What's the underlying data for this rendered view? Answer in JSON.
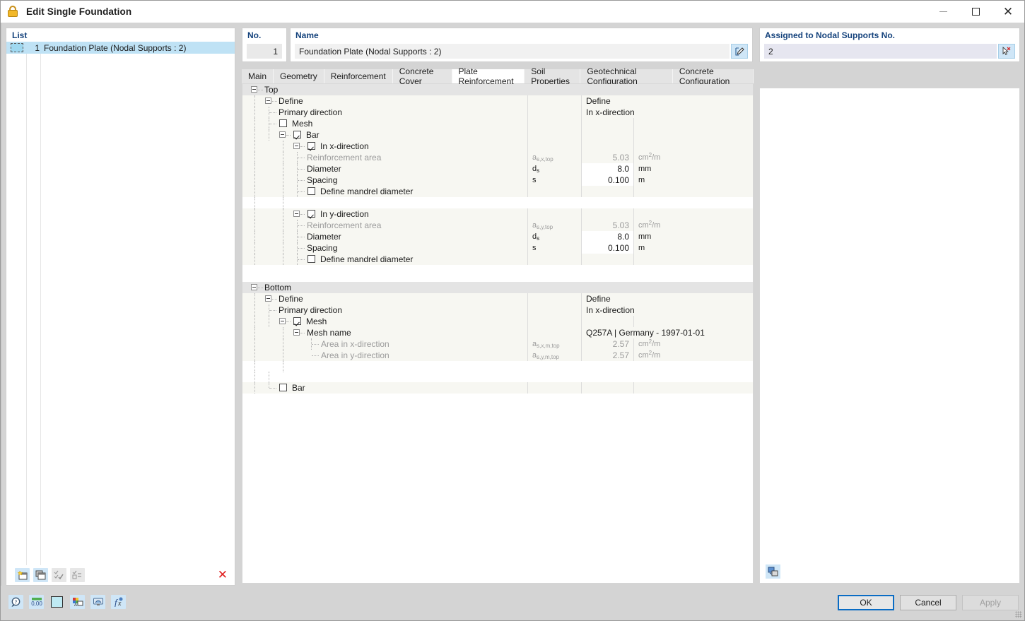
{
  "window": {
    "title": "Edit Single Foundation",
    "icon": "foundation-icon",
    "minimize": "−",
    "maximize": "□",
    "close": "✕"
  },
  "list_panel": {
    "header": "List",
    "rows": [
      {
        "number": "1",
        "label": "Foundation Plate (Nodal Supports : 2)",
        "selected": true
      }
    ],
    "toolbar": [
      {
        "name": "new-item-button",
        "enabled": true
      },
      {
        "name": "copy-item-button",
        "enabled": true
      },
      {
        "name": "select-all-button",
        "enabled": false
      },
      {
        "name": "invert-selection-button",
        "enabled": false
      }
    ],
    "delete_label": "✕"
  },
  "fields": {
    "no_label": "No.",
    "no_value": "1",
    "name_label": "Name",
    "name_value": "Foundation Plate (Nodal Supports : 2)",
    "name_edit_button": "edit-name-icon",
    "assigned_label": "Assigned to Nodal Supports No.",
    "assigned_value": "2",
    "assigned_pick_button": "pick-node-icon"
  },
  "tabs": [
    {
      "label": "Main",
      "active": false
    },
    {
      "label": "Geometry",
      "active": false
    },
    {
      "label": "Reinforcement",
      "active": false
    },
    {
      "label": "Concrete Cover",
      "active": false
    },
    {
      "label": "Plate Reinforcement",
      "active": true
    },
    {
      "label": "Soil Properties",
      "active": false
    },
    {
      "label": "Geotechnical Configuration",
      "active": false
    },
    {
      "label": "Concrete Configuration",
      "active": false
    }
  ],
  "tree": {
    "top": {
      "title": "Top",
      "define_label": "Define",
      "define_value": "Define",
      "primary_direction_label": "Primary direction",
      "primary_direction_value": "In x-direction",
      "mesh_label": "Mesh",
      "mesh_checked": false,
      "bar_label": "Bar",
      "bar_checked": true,
      "x_direction": {
        "label": "In x-direction",
        "checked": true,
        "reinforcement_area_label": "Reinforcement area",
        "reinforcement_area_symbol": "as,x,top",
        "reinforcement_area_value": "5.03",
        "reinforcement_area_unit": "cm2/m",
        "diameter_label": "Diameter",
        "diameter_symbol": "ds",
        "diameter_value": "8.0",
        "diameter_unit": "mm",
        "spacing_label": "Spacing",
        "spacing_symbol": "s",
        "spacing_value": "0.100",
        "spacing_unit": "m",
        "mandrel_label": "Define mandrel diameter",
        "mandrel_checked": false
      },
      "y_direction": {
        "label": "In y-direction",
        "checked": true,
        "reinforcement_area_label": "Reinforcement area",
        "reinforcement_area_symbol": "as,y,top",
        "reinforcement_area_value": "5.03",
        "reinforcement_area_unit": "cm2/m",
        "diameter_label": "Diameter",
        "diameter_symbol": "ds",
        "diameter_value": "8.0",
        "diameter_unit": "mm",
        "spacing_label": "Spacing",
        "spacing_symbol": "s",
        "spacing_value": "0.100",
        "spacing_unit": "m",
        "mandrel_label": "Define mandrel diameter",
        "mandrel_checked": false
      }
    },
    "bottom": {
      "title": "Bottom",
      "define_label": "Define",
      "define_value": "Define",
      "primary_direction_label": "Primary direction",
      "primary_direction_value": "In x-direction",
      "mesh_label": "Mesh",
      "mesh_checked": true,
      "mesh_name_label": "Mesh name",
      "mesh_name_value": "Q257A | Germany - 1997-01-01",
      "area_x_label": "Area in x-direction",
      "area_x_symbol": "as,x,m,top",
      "area_x_value": "2.57",
      "area_x_unit": "cm2/m",
      "area_y_label": "Area in y-direction",
      "area_y_symbol": "as,y,m,top",
      "area_y_value": "2.57",
      "area_y_unit": "cm2/m",
      "bar_label": "Bar",
      "bar_checked": false
    }
  },
  "graphics_panel": {
    "tool_icon": "render-settings-icon"
  },
  "bottom_bar": {
    "tools": [
      {
        "name": "help-icon"
      },
      {
        "name": "units-decimal-places-icon"
      },
      {
        "name": "color-swatch-icon"
      },
      {
        "name": "display-properties-icon"
      },
      {
        "name": "visual-settings-icon"
      },
      {
        "name": "formula-icon"
      }
    ],
    "ok_label": "OK",
    "cancel_label": "Cancel",
    "apply_label": "Apply"
  },
  "colors": {
    "accent_blue": "#14427c",
    "selection_blue": "#bfe2f5",
    "group_row": "#e4e4e4",
    "sub_row": "#f7f7f2",
    "delete_red": "#e02020",
    "ok_border": "#0a6cc4"
  }
}
